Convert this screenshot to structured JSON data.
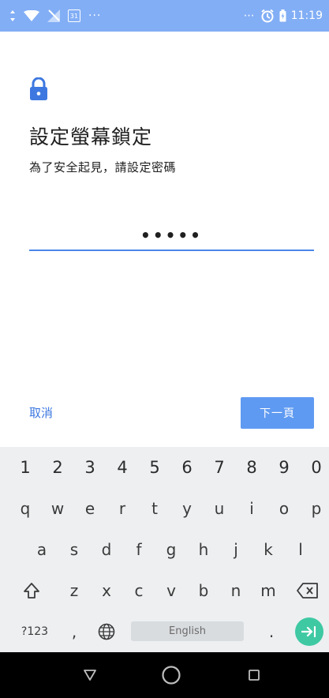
{
  "status_bar": {
    "background": "#82aef5",
    "left_icons": [
      "signal-icon",
      "wifi-icon",
      "no-sim-icon",
      "calendar-icon",
      "more-dots-icon"
    ],
    "calendar_day": "31",
    "right_dots": "⋯",
    "time": "11:19",
    "right_icons": [
      "alarm-icon",
      "battery-icon"
    ]
  },
  "screen": {
    "icon": "lock-icon",
    "accent": "#4a86e8",
    "title": "設定螢幕鎖定",
    "subtitle": "為了安全起見，請設定密碼",
    "password_value": "•••••",
    "cancel_label": "取消",
    "next_label": "下一頁"
  },
  "keyboard": {
    "number_row": [
      "1",
      "2",
      "3",
      "4",
      "5",
      "6",
      "7",
      "8",
      "9",
      "0"
    ],
    "row1": [
      "q",
      "w",
      "e",
      "r",
      "t",
      "y",
      "u",
      "i",
      "o",
      "p"
    ],
    "row2": [
      "a",
      "s",
      "d",
      "f",
      "g",
      "h",
      "j",
      "k",
      "l"
    ],
    "row3": [
      "z",
      "x",
      "c",
      "v",
      "b",
      "n",
      "m"
    ],
    "shift_icon": "shift-icon",
    "backspace_icon": "backspace-icon",
    "symbols_label": "?123",
    "comma_label": ",",
    "globe_icon": "globe-icon",
    "space_label": "English",
    "period_label": ".",
    "enter_icon": "next-arrow-icon",
    "enter_color": "#3ec9a3"
  },
  "nav_bar": {
    "icons": [
      "back-icon",
      "home-icon",
      "recents-icon"
    ]
  }
}
